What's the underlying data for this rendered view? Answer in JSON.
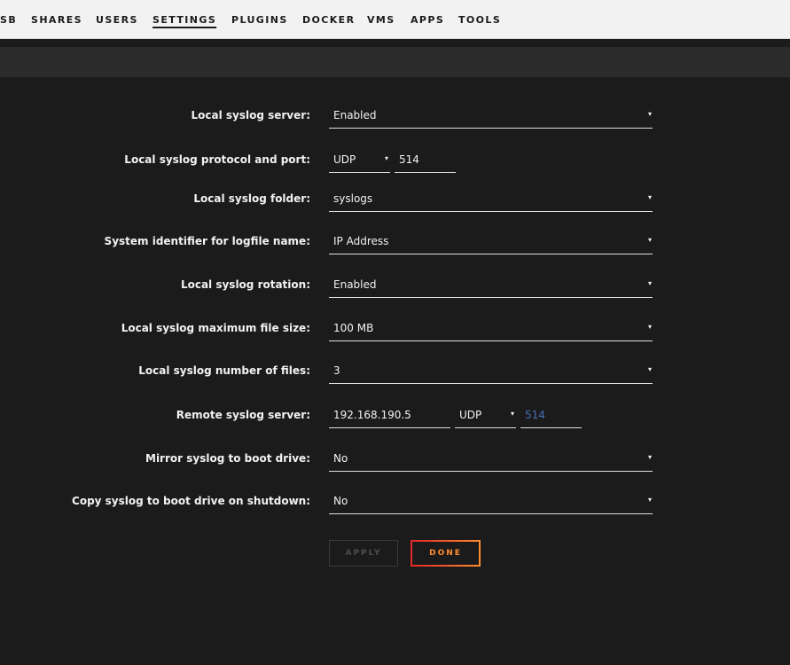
{
  "nav": {
    "items": [
      "SB",
      "SHARES",
      "USERS",
      "SETTINGS",
      "PLUGINS",
      "DOCKER",
      "VMS",
      "APPS",
      "TOOLS"
    ],
    "active": "SETTINGS"
  },
  "form": {
    "local_server": {
      "label": "Local syslog server:",
      "value": "Enabled"
    },
    "protocol_port": {
      "label": "Local syslog protocol and port:",
      "protocol": "UDP",
      "port": "514"
    },
    "folder": {
      "label": "Local syslog folder:",
      "value": "syslogs"
    },
    "identifier": {
      "label": "System identifier for logfile name:",
      "value": "IP Address"
    },
    "rotation": {
      "label": "Local syslog rotation:",
      "value": "Enabled"
    },
    "max_size": {
      "label": "Local syslog maximum file size:",
      "value": "100 MB"
    },
    "num_files": {
      "label": "Local syslog number of files:",
      "value": "3"
    },
    "remote": {
      "label": "Remote syslog server:",
      "address": "192.168.190.5",
      "protocol": "UDP",
      "port": "514"
    },
    "mirror": {
      "label": "Mirror syslog to boot drive:",
      "value": "No"
    },
    "copy_shutdown": {
      "label": "Copy syslog to boot drive on shutdown:",
      "value": "No"
    }
  },
  "buttons": {
    "apply": "APPLY",
    "done": "DONE"
  },
  "icons": {
    "dropdown": "▾"
  },
  "colors": {
    "accent_orange": "#ff8c2f",
    "accent_red": "#e22828",
    "port_blue": "#486dba"
  }
}
